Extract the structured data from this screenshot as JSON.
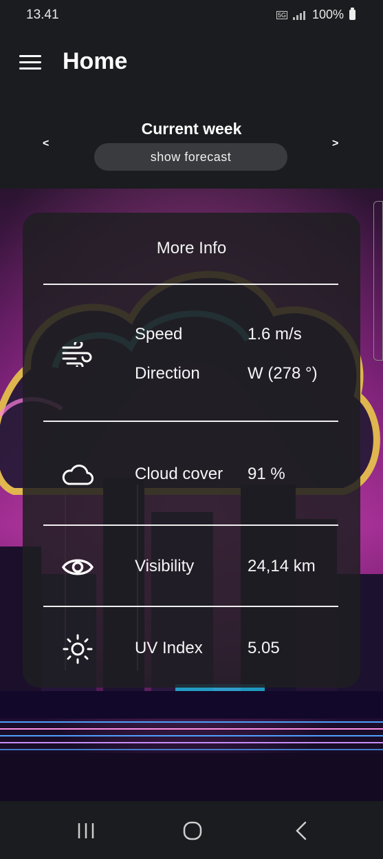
{
  "status_bar": {
    "time": "13.41",
    "network": "5G",
    "battery": "100%"
  },
  "app_bar": {
    "title": "Home"
  },
  "week_nav": {
    "title": "Current week",
    "prev": "<",
    "next": ">",
    "forecast_button": "show forecast"
  },
  "more_info": {
    "title": "More Info",
    "wind": {
      "speed_label": "Speed",
      "speed_value": "1.6 m/s",
      "direction_label": "Direction",
      "direction_value": "W (278 °)"
    },
    "cloud": {
      "label": "Cloud cover",
      "value": "91 %"
    },
    "visibility": {
      "label": "Visibility",
      "value": "24,14 km"
    },
    "uv": {
      "label": "UV Index",
      "value": "5.05"
    }
  },
  "icons": [
    "wind-icon",
    "cloud-icon",
    "eye-icon",
    "sun-icon"
  ]
}
